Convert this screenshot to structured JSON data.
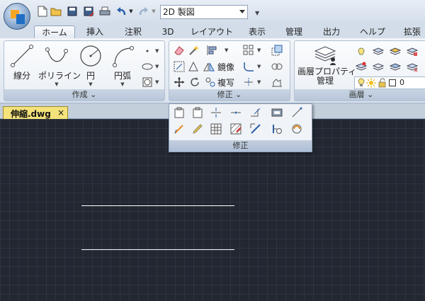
{
  "qat": {
    "icons": [
      "new-icon",
      "open-icon",
      "save-icon",
      "save-as-icon",
      "print-icon",
      "undo-icon",
      "redo-icon"
    ],
    "workspace": "2D 製図"
  },
  "tabs": [
    "ホーム",
    "挿入",
    "注釈",
    "3D",
    "レイアウト",
    "表示",
    "管理",
    "出力",
    "ヘルプ",
    "拡張"
  ],
  "active_tab": "ホーム",
  "ribbon": {
    "draw": {
      "title": "作成",
      "line": "線分",
      "polyline": "ポリライン",
      "circle": "円",
      "arc": "円弧"
    },
    "modify": {
      "title": "修正",
      "mirror": "鏡像",
      "copy": "複写"
    },
    "layer": {
      "title": "画層",
      "properties_line1": "画層プロパティ",
      "properties_line2": "管理",
      "current_layer": "0"
    }
  },
  "flyout": {
    "title": "修正"
  },
  "document": {
    "tab_name": "伸縮.dwg",
    "close": "×"
  },
  "colors": {
    "canvas": "#222731",
    "grid": "#2e3540",
    "doc_tab": "#f4e37a",
    "accent": "#1f6fc5"
  }
}
